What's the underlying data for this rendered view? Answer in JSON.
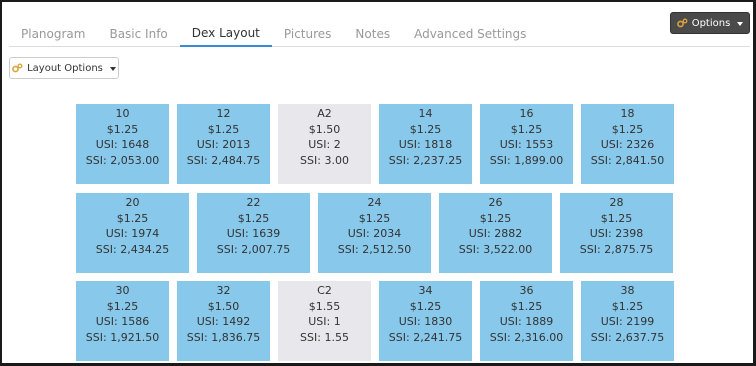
{
  "tabs": [
    {
      "label": "Planogram",
      "active": false
    },
    {
      "label": "Basic Info",
      "active": false
    },
    {
      "label": "Dex Layout",
      "active": true
    },
    {
      "label": "Pictures",
      "active": false
    },
    {
      "label": "Notes",
      "active": false
    },
    {
      "label": "Advanced Settings",
      "active": false
    }
  ],
  "options_button": {
    "label": "Options",
    "icon": "cogs-icon"
  },
  "layout_options_button": {
    "label": "Layout Options",
    "icon": "cogs-icon"
  },
  "colors": {
    "filled_slot": "#88c8ea",
    "empty_slot": "#e8e8ec",
    "active_tab_underline": "#3a8cd2",
    "options_button_bg": "#4a4a4a",
    "icon_gold": "#d9a43a"
  },
  "rows": [
    {
      "slots": [
        {
          "code": "10",
          "price": "$1.25",
          "usi": "USI: 1648",
          "ssi": "SSI: 2,053.00",
          "filled": true
        },
        {
          "code": "12",
          "price": "$1.25",
          "usi": "USI: 2013",
          "ssi": "SSI: 2,484.75",
          "filled": true
        },
        {
          "code": "A2",
          "price": "$1.50",
          "usi": "USI: 2",
          "ssi": "SSI: 3.00",
          "filled": false
        },
        {
          "code": "14",
          "price": "$1.25",
          "usi": "USI: 1818",
          "ssi": "SSI: 2,237.25",
          "filled": true
        },
        {
          "code": "16",
          "price": "$1.25",
          "usi": "USI: 1553",
          "ssi": "SSI: 1,899.00",
          "filled": true
        },
        {
          "code": "18",
          "price": "$1.25",
          "usi": "USI: 2326",
          "ssi": "SSI: 2,841.50",
          "filled": true
        }
      ]
    },
    {
      "slots": [
        {
          "code": "20",
          "price": "$1.25",
          "usi": "USI: 1974",
          "ssi": "SSI: 2,434.25",
          "filled": true
        },
        {
          "code": "22",
          "price": "$1.25",
          "usi": "USI: 1639",
          "ssi": "SSI: 2,007.75",
          "filled": true
        },
        {
          "code": "24",
          "price": "$1.25",
          "usi": "USI: 2034",
          "ssi": "SSI: 2,512.50",
          "filled": true
        },
        {
          "code": "26",
          "price": "$1.25",
          "usi": "USI: 2882",
          "ssi": "SSI: 3,522.00",
          "filled": true
        },
        {
          "code": "28",
          "price": "$1.25",
          "usi": "USI: 2398",
          "ssi": "SSI: 2,875.75",
          "filled": true
        }
      ]
    },
    {
      "slots": [
        {
          "code": "30",
          "price": "$1.25",
          "usi": "USI: 1586",
          "ssi": "SSI: 1,921.50",
          "filled": true
        },
        {
          "code": "32",
          "price": "$1.50",
          "usi": "USI: 1492",
          "ssi": "SSI: 1,836.75",
          "filled": true
        },
        {
          "code": "C2",
          "price": "$1.55",
          "usi": "USI: 1",
          "ssi": "SSI: 1.55",
          "filled": false
        },
        {
          "code": "34",
          "price": "$1.25",
          "usi": "USI: 1830",
          "ssi": "SSI: 2,241.75",
          "filled": true
        },
        {
          "code": "36",
          "price": "$1.25",
          "usi": "USI: 1889",
          "ssi": "SSI: 2,316.00",
          "filled": true
        },
        {
          "code": "38",
          "price": "$1.25",
          "usi": "USI: 2199",
          "ssi": "SSI: 2,637.75",
          "filled": true
        }
      ]
    }
  ]
}
